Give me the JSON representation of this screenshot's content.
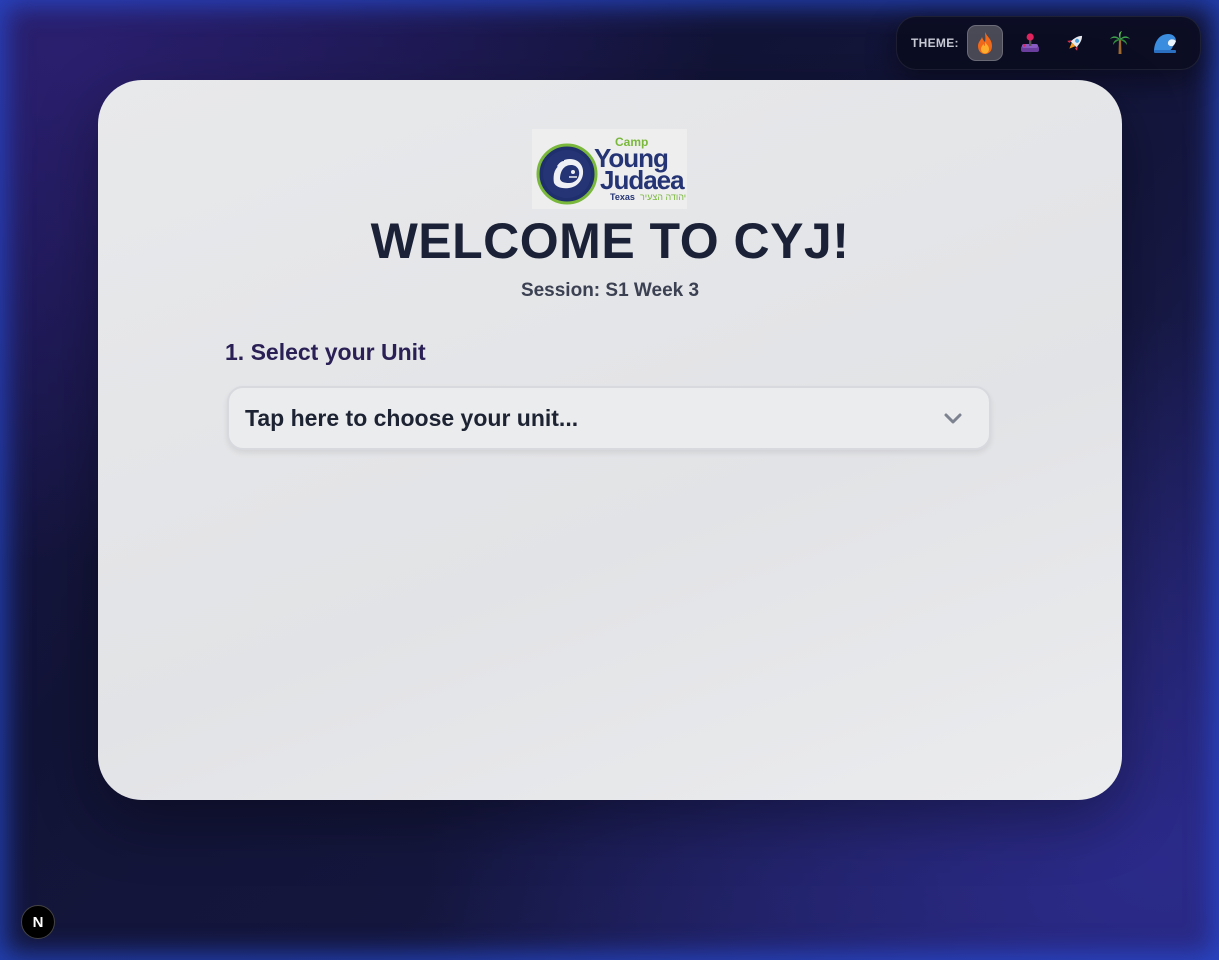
{
  "theme_switcher": {
    "label": "THEME:",
    "options": [
      {
        "name": "fire",
        "icon": "fire-icon",
        "active": true
      },
      {
        "name": "joystick",
        "icon": "joystick-icon",
        "active": false
      },
      {
        "name": "rocket",
        "icon": "rocket-icon",
        "active": false
      },
      {
        "name": "palm",
        "icon": "palm-tree-icon",
        "active": false
      },
      {
        "name": "wave",
        "icon": "wave-icon",
        "active": false
      }
    ]
  },
  "logo": {
    "camp": "Camp",
    "young": "Young",
    "judaea": "Judaea",
    "texas": "Texas",
    "hebrew": "יהודה הצעיר"
  },
  "welcome": {
    "title": "WELCOME TO CYJ!",
    "session": "Session: S1 Week 3"
  },
  "unit_step": {
    "label": "1. Select your Unit",
    "placeholder": "Tap here to choose your unit..."
  },
  "dev_badge": {
    "letter": "N"
  }
}
